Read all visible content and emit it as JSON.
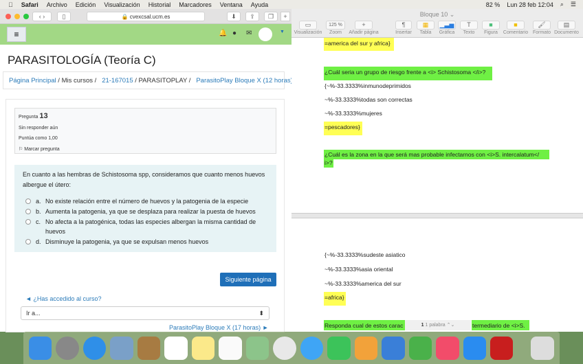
{
  "menubar": {
    "app": "Safari",
    "items": [
      "Archivo",
      "Edición",
      "Visualización",
      "Historial",
      "Marcadores",
      "Ventana",
      "Ayuda"
    ],
    "battery": "82 %",
    "datetime": "Lun 28 feb  12:04"
  },
  "safari": {
    "url": "cvexcsal.ucm.es",
    "page_title": "PARASITOLOGÍA (Teoría C)",
    "breadcrumb": [
      "Página Principal",
      "Mis cursos",
      "21-167015",
      "PARASITOPLAY",
      "ParasitoPlay Bloque X (12 horas)"
    ],
    "question": {
      "label": "Pregunta",
      "number": "13",
      "status": "Sin responder aún",
      "score": "Puntúa como 1,00",
      "flag": "Marcar pregunta",
      "text": "En cuanto a las hembras de Schistosoma spp, consideramos que cuanto menos huevos albergue el útero:",
      "options": [
        {
          "letter": "a.",
          "text": "No existe relación entre el número de huevos y la patogenia de la especie"
        },
        {
          "letter": "b.",
          "text": "Aumenta la patogenia, ya que se desplaza para realizar la puesta de huevos"
        },
        {
          "letter": "c.",
          "text": "No afecta a la patogénica, todas las especies albergan la misma cantidad de huevos"
        },
        {
          "letter": "d.",
          "text": "Disminuye la patogenia, ya que se expulsan menos huevos"
        }
      ]
    },
    "next_button": "Siguiente página",
    "prev_link": "◄ ¿Has accedido al curso?",
    "jump_select": "Ir a...",
    "next_link": "ParasitoPlay Bloque X (17 horas) ►"
  },
  "pages": {
    "title": "Bloque 10",
    "toolbar": [
      "Visualización",
      "Zoom",
      "Añadir página",
      "Insertar",
      "Tabla",
      "Gráfica",
      "Texto",
      "Figura",
      "Comentario",
      "Formato",
      "Documento"
    ],
    "zoom": "125 %",
    "lines": [
      "=america del sur y africa}",
      "¿Cuál seria un grupo de riesgo frente a <i> Schistosoma </i>?",
      "{~%-33.3333%inmunodeprimidos",
      "~%-33.3333%todas son correctas",
      "~%-33.3333%mujeres",
      "=pescadores}",
      "¿Cuál es la zona en la que será mas probable infectarnos con <i>S. intercalatum</",
      "i>?",
      "{~%-33.3333%sudeste asiatico",
      "~%-33.3333%asia oriental",
      "~%-33.3333%america del sur",
      "=africa}",
      "Responda cual de estos carac",
      "termediario de <i>S."
    ],
    "word_count": "1 palabra"
  }
}
